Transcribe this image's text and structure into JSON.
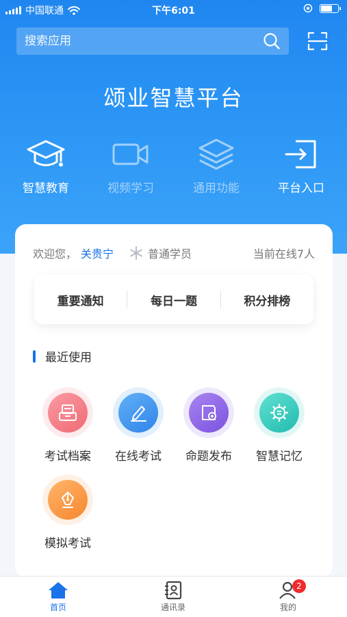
{
  "status": {
    "carrier": "中国联通",
    "time": "下午6:01"
  },
  "search": {
    "placeholder": "搜索应用"
  },
  "header": {
    "title": "颂业智慧平台"
  },
  "categories": [
    {
      "label": "智慧教育",
      "icon": "graduation-cap-icon",
      "active": true
    },
    {
      "label": "视频学习",
      "icon": "video-camera-icon",
      "active": false
    },
    {
      "label": "通用功能",
      "icon": "layers-icon",
      "active": false
    },
    {
      "label": "平台入口",
      "icon": "login-icon",
      "active": true
    }
  ],
  "welcome": {
    "greeting": "欢迎您，",
    "name": "关贵宁",
    "grade": "普通学员",
    "online": "当前在线7人"
  },
  "quick": [
    "重要通知",
    "每日一题",
    "积分排榜"
  ],
  "recent": {
    "title": "最近使用",
    "apps": [
      {
        "label": "考试档案",
        "icon": "archive-box-icon",
        "color": "#f47a84"
      },
      {
        "label": "在线考试",
        "icon": "pen-edit-icon",
        "color": "#3e94f0"
      },
      {
        "label": "命题发布",
        "icon": "document-add-icon",
        "color": "#8c64e8"
      },
      {
        "label": "智慧记忆",
        "icon": "gear-list-icon",
        "color": "#34cbbd"
      },
      {
        "label": "模拟考试",
        "icon": "pen-nib-icon",
        "color": "#fb9a4a"
      }
    ]
  },
  "tabs": [
    {
      "label": "首页",
      "icon": "home-icon",
      "active": true
    },
    {
      "label": "通讯录",
      "icon": "contacts-icon",
      "active": false
    },
    {
      "label": "我的",
      "icon": "user-icon",
      "active": false,
      "badge": "2"
    }
  ],
  "colors": {
    "primary": "#1f86f0",
    "accent_text": "#1a73e8",
    "badge": "#f02b2b"
  }
}
